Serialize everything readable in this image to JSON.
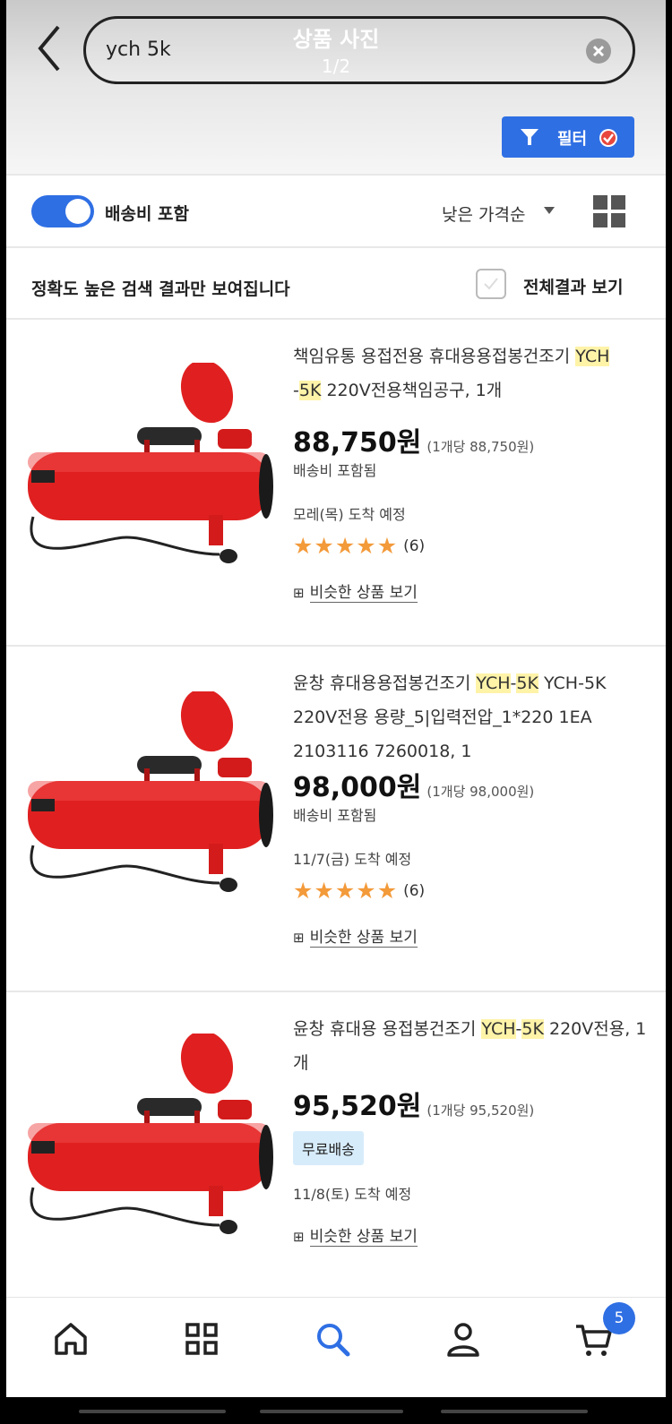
{
  "header": {
    "search_query": "ych 5k",
    "photo_title": "상품 사진",
    "photo_count": "1/2",
    "filter_label": "필터"
  },
  "options": {
    "shipping_toggle_label": "배송비 포함",
    "shipping_toggle_on": true,
    "sort_label": "낮은 가격순",
    "notice": "정확도 높은 검색 결과만 보여집니다",
    "all_results_label": "전체결과 보기"
  },
  "products": [
    {
      "title_parts": [
        "책임유통 용접전용 휴대용용접봉건조기 ",
        "YCH",
        "\n-",
        "5K",
        " 220V전용책임공구, 1개"
      ],
      "price": "88,750원",
      "unit_price": "(1개당 88,750원)",
      "shipping": "배송비 포함됨",
      "arrival": "모레(목) 도착 예정",
      "stars": 5,
      "rating_count": "(6)",
      "similar": "비슷한 상품 보기"
    },
    {
      "title_parts": [
        "윤창 휴대용용접봉건조기 ",
        "YCH",
        "-",
        "5K",
        " YCH-5K 220V전용 용량_5|입력전압_1*220 1EA 2103116 7260018, 1"
      ],
      "price": "98,000원",
      "unit_price": "(1개당 98,000원)",
      "shipping": "배송비 포함됨",
      "arrival": "11/7(금) 도착 예정",
      "stars": 5,
      "rating_count": "(6)",
      "similar": "비슷한 상품 보기"
    },
    {
      "title_parts": [
        "윤창 휴대용 용접봉건조기 ",
        "YCH",
        "-",
        "5K",
        " 220V전용, 1개"
      ],
      "price": "95,520원",
      "unit_price": "(1개당 95,520원)",
      "shipping_badge": "무료배송",
      "arrival": "11/8(토) 도착 예정",
      "similar": "비슷한 상품 보기"
    }
  ],
  "bottom_nav": {
    "items": [
      "home-icon",
      "category-icon",
      "search-icon",
      "user-icon",
      "cart-icon"
    ],
    "cart_count": "5"
  },
  "colors": {
    "accent": "#2f6fe4",
    "highlight": "#fff3a8",
    "star": "#f39a3a",
    "badge_bg": "#d7ecfb",
    "product_red": "#e02020"
  }
}
